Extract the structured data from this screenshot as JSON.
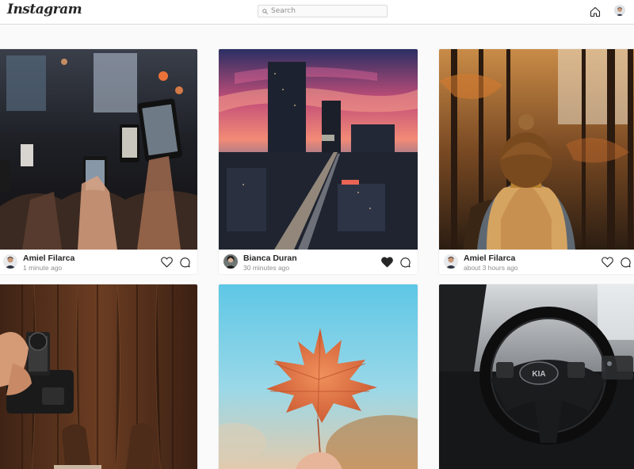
{
  "header": {
    "logo": "Instagram",
    "search_placeholder": "Search"
  },
  "posts": [
    {
      "user": "Amiel Filarca",
      "time": "1 minute ago",
      "liked": false,
      "image": "concert-phones"
    },
    {
      "user": "Bianca Duran",
      "time": "30 minutes ago",
      "liked": true,
      "image": "city-sunset"
    },
    {
      "user": "Amiel Filarca",
      "time": "about 3 hours ago",
      "liked": false,
      "image": "forest-girl"
    },
    {
      "user": "",
      "time": "",
      "liked": false,
      "image": "camera-wood-floor"
    },
    {
      "user": "",
      "time": "",
      "liked": false,
      "image": "autumn-leaf"
    },
    {
      "user": "",
      "time": "",
      "liked": false,
      "image": "car-steering-wheel"
    }
  ],
  "colors": {
    "background": "#fafafa",
    "border": "#dbdbdb",
    "text": "#262626",
    "muted": "#8e8e8e"
  }
}
